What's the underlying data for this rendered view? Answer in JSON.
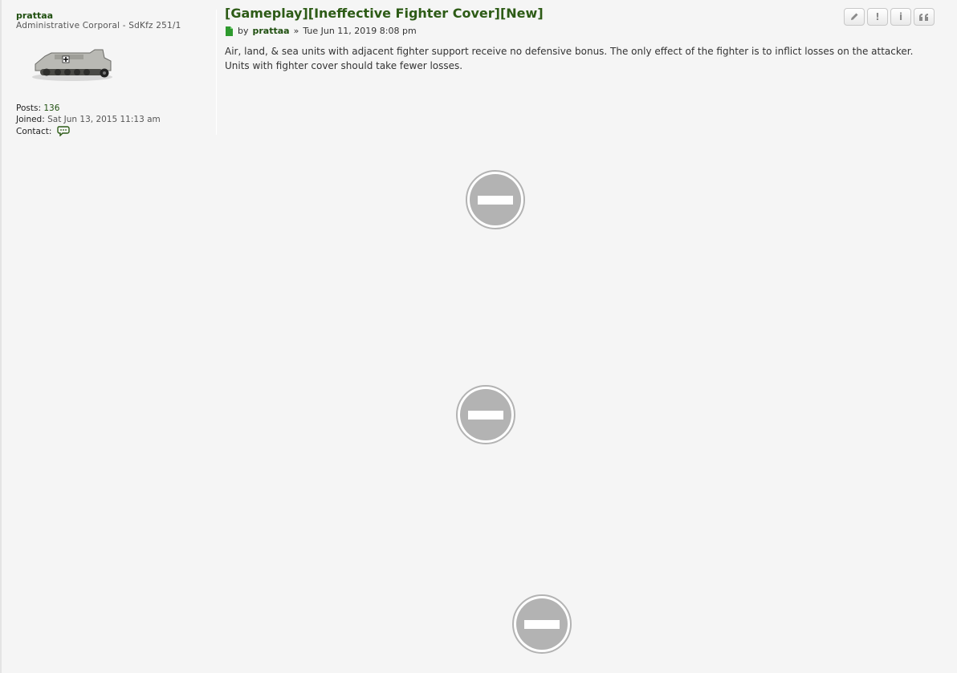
{
  "profile": {
    "username": "prattaa",
    "rank": "Administrative Corporal - SdKfz 251/1",
    "posts_label": "Posts:",
    "posts_value": "136",
    "joined_label": "Joined:",
    "joined_value": "Sat Jun 13, 2015 11:13 am",
    "contact_label": "Contact:",
    "avatar_icon": "halftrack-vehicle-avatar",
    "contact_icon": "chat-bubbles-icon"
  },
  "post": {
    "title": "[Gameplay][Ineffective Fighter Cover][New]",
    "by_label": "by",
    "author": "prattaa",
    "separator": "»",
    "date": "Tue Jun 11, 2019 8:08 pm",
    "content": "Air, land, & sea units with adjacent fighter support receive no defensive bonus. The only effect of the fighter is to inflict losses on the attacker. Units with fighter cover should take fewer losses."
  },
  "actions": [
    {
      "name": "edit-button",
      "icon": "pencil-icon"
    },
    {
      "name": "report-button",
      "icon": "exclamation-icon",
      "glyph": "!"
    },
    {
      "name": "info-button",
      "icon": "info-icon",
      "glyph": "i"
    },
    {
      "name": "quote-button",
      "icon": "quote-icon"
    }
  ],
  "blocked_media": [
    {
      "icon": "blocked-content-icon"
    },
    {
      "icon": "blocked-content-icon"
    },
    {
      "icon": "blocked-content-icon"
    }
  ],
  "colors": {
    "title": "#2d5b16",
    "link": "#1f4f0f",
    "background": "#f5f5f5",
    "blocked_gray": "#b3b3b3"
  }
}
